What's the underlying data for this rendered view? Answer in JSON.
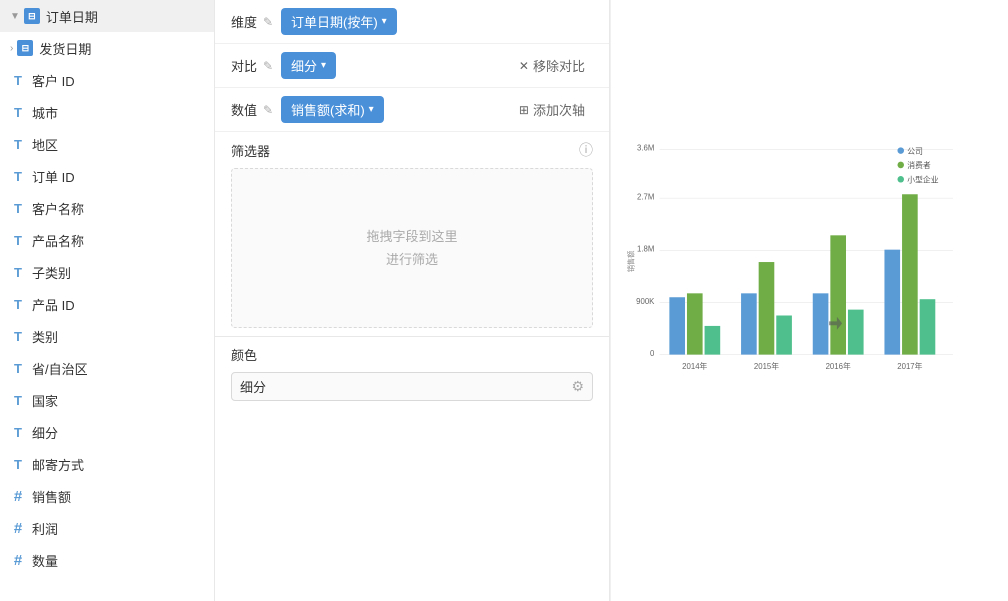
{
  "sidebar": {
    "items": [
      {
        "label": "订单日期",
        "icon_type": "blue_box",
        "icon_text": "⊞",
        "has_expand": true,
        "has_arrow": true,
        "indent": 0
      },
      {
        "label": "发货日期",
        "icon_type": "blue_box",
        "icon_text": "⊞",
        "has_expand": false,
        "has_arrow": true,
        "indent": 0
      },
      {
        "label": "客户 ID",
        "icon_type": "t",
        "icon_text": "T",
        "has_expand": false,
        "indent": 0
      },
      {
        "label": "城市",
        "icon_type": "t",
        "icon_text": "T",
        "has_expand": false,
        "indent": 0
      },
      {
        "label": "地区",
        "icon_type": "t",
        "icon_text": "T",
        "has_expand": false,
        "indent": 0
      },
      {
        "label": "订单 ID",
        "icon_type": "t",
        "icon_text": "T",
        "has_expand": false,
        "indent": 0
      },
      {
        "label": "客户名称",
        "icon_type": "t",
        "icon_text": "T",
        "has_expand": false,
        "indent": 0
      },
      {
        "label": "产品名称",
        "icon_type": "t",
        "icon_text": "T",
        "has_expand": false,
        "indent": 0
      },
      {
        "label": "子类别",
        "icon_type": "t",
        "icon_text": "T",
        "has_expand": false,
        "indent": 0
      },
      {
        "label": "产品 ID",
        "icon_type": "t",
        "icon_text": "T",
        "has_expand": false,
        "indent": 0
      },
      {
        "label": "类别",
        "icon_type": "t",
        "icon_text": "T",
        "has_expand": false,
        "indent": 0
      },
      {
        "label": "省/自治区",
        "icon_type": "t",
        "icon_text": "T",
        "has_expand": false,
        "indent": 0
      },
      {
        "label": "国家",
        "icon_type": "t",
        "icon_text": "T",
        "has_expand": false,
        "indent": 0
      },
      {
        "label": "细分",
        "icon_type": "t",
        "icon_text": "T",
        "has_expand": false,
        "indent": 0
      },
      {
        "label": "邮寄方式",
        "icon_type": "t",
        "icon_text": "T",
        "has_expand": false,
        "indent": 0
      },
      {
        "label": "销售额",
        "icon_type": "hash",
        "icon_text": "#",
        "has_expand": false,
        "indent": 0
      },
      {
        "label": "利润",
        "icon_type": "hash",
        "icon_text": "#",
        "has_expand": false,
        "indent": 0
      },
      {
        "label": "数量",
        "icon_type": "hash",
        "icon_text": "#",
        "has_expand": false,
        "indent": 0
      }
    ]
  },
  "controls": {
    "dimension_label": "维度",
    "dimension_value": "订单日期(按年)",
    "contrast_label": "对比",
    "contrast_value": "细分",
    "value_label": "数值",
    "value_value": "销售额(求和)",
    "remove_contrast": "移除对比",
    "add_axis": "添加次轴",
    "edit_icon": "✎",
    "filter_title": "筛选器",
    "filter_placeholder_line1": "拖拽字段到这里",
    "filter_placeholder_line2": "进行筛选",
    "color_title": "颜色",
    "color_value": "细分",
    "info_icon": "ⓘ"
  },
  "chart": {
    "y_axis_label": "销售额",
    "y_labels": [
      "3.6M",
      "2.7M",
      "1.8M",
      "900K",
      "0"
    ],
    "x_labels": [
      "2014年",
      "2015年",
      "2016年",
      "2017年"
    ],
    "legend": [
      {
        "label": "公司",
        "color": "#5b9bd5"
      },
      {
        "label": "消费者",
        "color": "#70ad47"
      },
      {
        "label": "小型企业",
        "color": "#4fc08d"
      }
    ],
    "bars": {
      "2014": {
        "公司": 0.28,
        "消费者": 0.3,
        "小型企业": 0.14
      },
      "2015": {
        "公司": 0.3,
        "消费者": 0.45,
        "小型企业": 0.19
      },
      "2016": {
        "公司": 0.3,
        "消费者": 0.58,
        "小型企业": 0.22
      },
      "2017": {
        "公司": 0.51,
        "消费者": 0.78,
        "小型企业": 0.27
      }
    }
  }
}
